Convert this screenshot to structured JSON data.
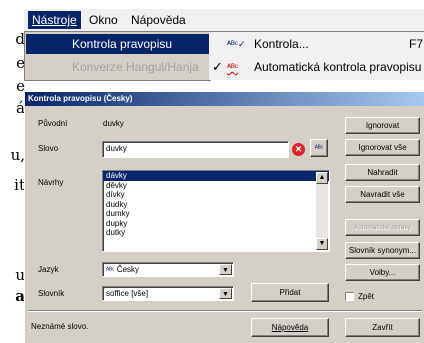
{
  "background_document": {
    "lines": [
      "d",
      "e",
      "e",
      "á",
      "u,",
      "it",
      "u",
      "a"
    ]
  },
  "menubar": {
    "items": [
      "Nástroje",
      "Okno",
      "Nápověda"
    ],
    "active": "Nástroje"
  },
  "tools_menu": {
    "items": [
      {
        "label": "Kontrola pravopisu",
        "highlighted": true,
        "disabled": false
      },
      {
        "label": "Konverze Hangul/Hanja",
        "highlighted": false,
        "disabled": true
      }
    ]
  },
  "spell_submenu": {
    "items": [
      {
        "label": "Kontrola...",
        "shortcut": "F7",
        "checked": false,
        "icon": "spellcheck-icon"
      },
      {
        "label": "Automatická kontrola pravopisu",
        "checked": true,
        "icon": "auto-spellcheck-icon"
      }
    ]
  },
  "dialog": {
    "title": "Kontrola pravopisu (Česky)",
    "original_label": "Původní",
    "original_value": "duvky",
    "word_label": "Slovo",
    "word_value": "duvky",
    "suggestions_label": "Návrhy",
    "suggestions": [
      "dávky",
      "děvky",
      "dívky",
      "dudky",
      "dumky",
      "dupky",
      "dutky"
    ],
    "selected_suggestion": "dávky",
    "language_label": "Jazyk",
    "language_value": "Česky",
    "dictionary_label": "Slovník",
    "dictionary_value": "soffice [vše]",
    "add_button": "Přidat",
    "ignore_button": "Ignorovat",
    "ignore_all_button": "Ignorovat vše",
    "replace_button": "Nahradit",
    "replace_all_button": "Navradit vše",
    "autocorrect_button": "Automatické opravy",
    "thesaurus_button": "Slovník synonym...",
    "options_button": "Volby...",
    "back_label": "Zpět",
    "status_text": "Neznámé slovo.",
    "help_button": "Nápověda",
    "close_button": "Zavřít",
    "colors": {
      "title_start": "#0a246a",
      "title_end": "#a6caf0",
      "error_icon": "#e0202a",
      "face": "#d4d0c8"
    }
  }
}
